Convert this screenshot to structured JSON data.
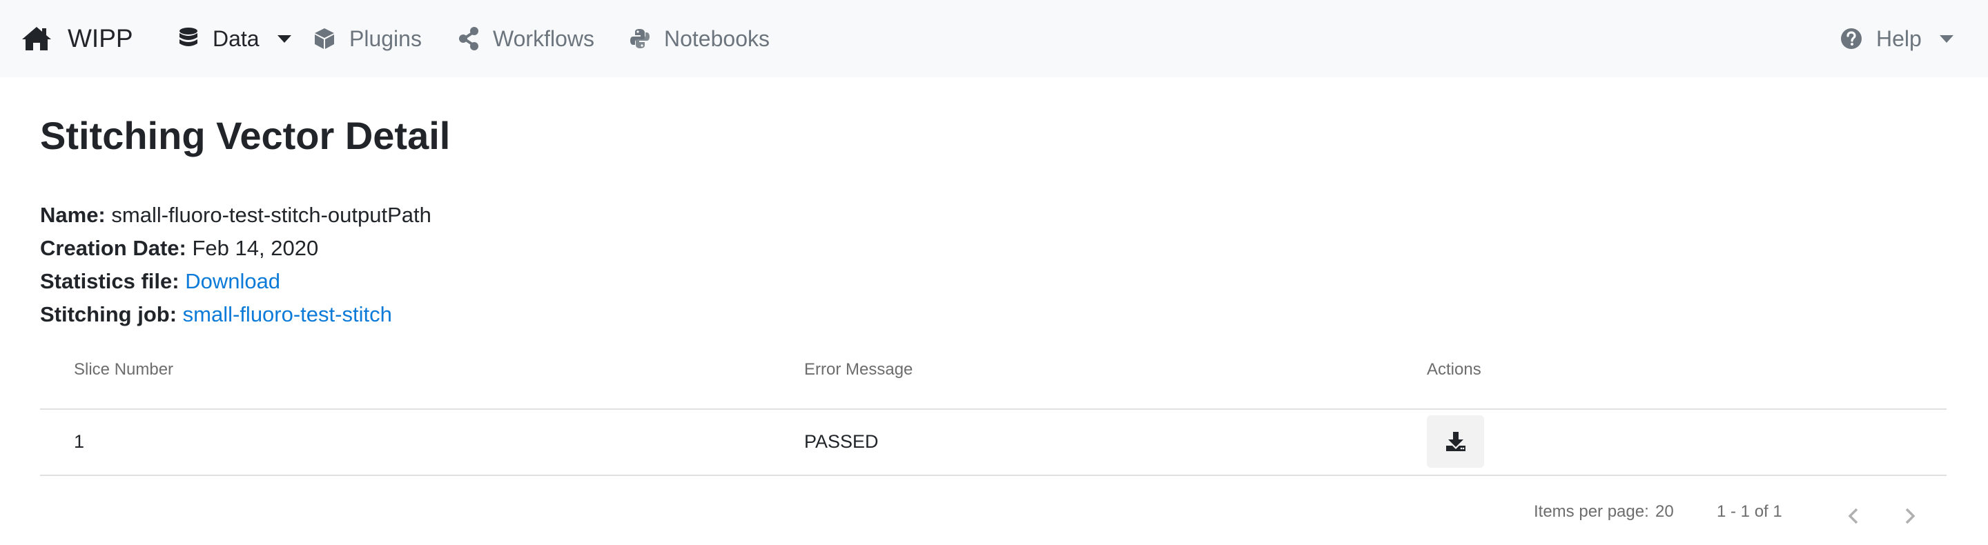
{
  "navbar": {
    "brand": {
      "label": "WIPP",
      "icon": "home-icon"
    },
    "items": [
      {
        "label": "Data",
        "icon": "database-icon",
        "dropdown": true,
        "active": true
      },
      {
        "label": "Plugins",
        "icon": "cube-icon"
      },
      {
        "label": "Workflows",
        "icon": "share-icon"
      },
      {
        "label": "Notebooks",
        "icon": "python-icon"
      }
    ],
    "help": {
      "label": "Help",
      "icon": "question-circle-icon",
      "dropdown": true
    }
  },
  "page": {
    "title": "Stitching Vector Detail",
    "details": [
      {
        "label": "Name:",
        "value": "small-fluoro-test-stitch-outputPath"
      },
      {
        "label": "Creation Date:",
        "value": "Feb 14, 2020"
      },
      {
        "label": "Statistics file:",
        "link": "Download"
      },
      {
        "label": "Stitching job:",
        "link": "small-fluoro-test-stitch"
      }
    ]
  },
  "table": {
    "headers": [
      "Slice Number",
      "Error Message",
      "Actions"
    ],
    "rows": [
      {
        "slice": "1",
        "error": "PASSED",
        "action_icon": "download-icon"
      }
    ]
  },
  "paginator": {
    "items_per_page_label": "Items per page:",
    "items_per_page": "20",
    "range": "1 - 1 of 1"
  },
  "colors": {
    "navbar_bg": "#f8f9fa",
    "link": "#0b7ad8",
    "muted": "#6c757d"
  }
}
